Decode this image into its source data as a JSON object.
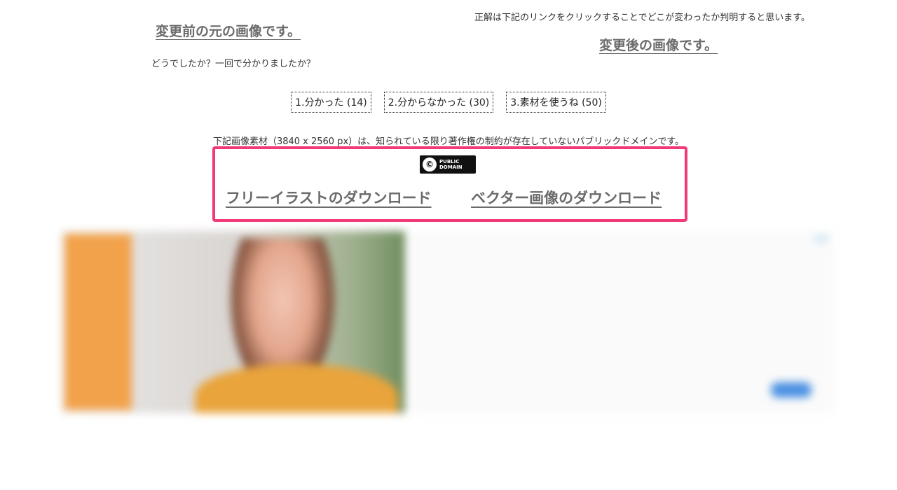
{
  "header": {
    "before_link": "変更前の元の画像です。",
    "hint": "正解は下記のリンクをクリックすることでどこが変わったか判明すると思います。",
    "after_link": "変更後の画像です。",
    "question": "どうでしたか？一回で分かりましたか？"
  },
  "votes": [
    {
      "label": "1.分かった (14)"
    },
    {
      "label": "2.分からなかった (30)"
    },
    {
      "label": "3.素材を使うね (50)"
    }
  ],
  "license": {
    "note": "下記画像素材（3840 x 2560 px）は、知られている限り著作権の制約が存在していないパブリックドメインです。",
    "badge_line1": "PUBLIC",
    "badge_line2": "DOMAIN",
    "badge_symbol": "©"
  },
  "downloads": {
    "free_illust": "フリーイラストのダウンロード",
    "vector": "ベクター画像のダウンロード"
  },
  "colors": {
    "highlight": "#f23a7a",
    "link": "#6b6b6b",
    "ad_orange": "#f2a24a",
    "ad_cta": "#4a90e2"
  },
  "ad": {
    "vertical_text": "",
    "title": "",
    "description": "",
    "advertiser": "",
    "footer1": "",
    "footer2": ""
  }
}
